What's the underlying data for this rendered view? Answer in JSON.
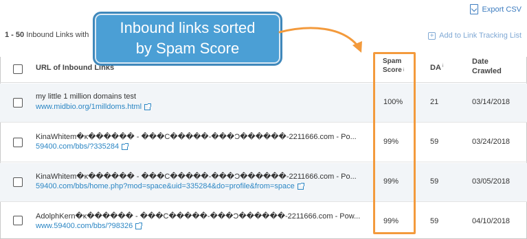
{
  "toolbar": {
    "export_label": "Export CSV",
    "range_prefix": "1 - 50",
    "range_label": "Inbound Links with",
    "add_tracking_label": "Add to Link Tracking List"
  },
  "table": {
    "columns": {
      "url": "URL of Inbound Links",
      "spam_line1": "Spam",
      "spam_line2": "Score",
      "da": "DA",
      "date_line1": "Date",
      "date_line2": "Crawled"
    },
    "rows": [
      {
        "title": "my little 1 million domains test",
        "url": "www.midbio.org/1milldoms.html",
        "spam": "100%",
        "da": "21",
        "date": "03/14/2018"
      },
      {
        "title": "KinaWhitem�κ������ - ���C�����-���Ͻ������-2211666.com - Po...",
        "url": "59400.com/bbs/?335284",
        "spam": "99%",
        "da": "59",
        "date": "03/24/2018"
      },
      {
        "title": "KinaWhitem�κ������ - ���C�����-���Ͻ������-2211666.com - Po...",
        "url": "59400.com/bbs/home.php?mod=space&uid=335284&do=profile&from=space",
        "spam": "99%",
        "da": "59",
        "date": "03/05/2018"
      },
      {
        "title": "AdolphKern�κ������ - ���C�����-���Ͻ������-2211666.com - Pow...",
        "url": "www.59400.com/bbs/?98326",
        "spam": "99%",
        "da": "59",
        "date": "04/10/2018"
      }
    ]
  },
  "annotation": {
    "line1": "Inbound links sorted",
    "line2": "by Spam Score"
  },
  "colors": {
    "accent": "#f39a3c",
    "callout": "#4b9fd5",
    "link": "#2b86c4"
  },
  "icons": {
    "export": "download-file-icon",
    "add": "plus-square-icon",
    "external": "external-link-icon",
    "info": "info-icon"
  }
}
